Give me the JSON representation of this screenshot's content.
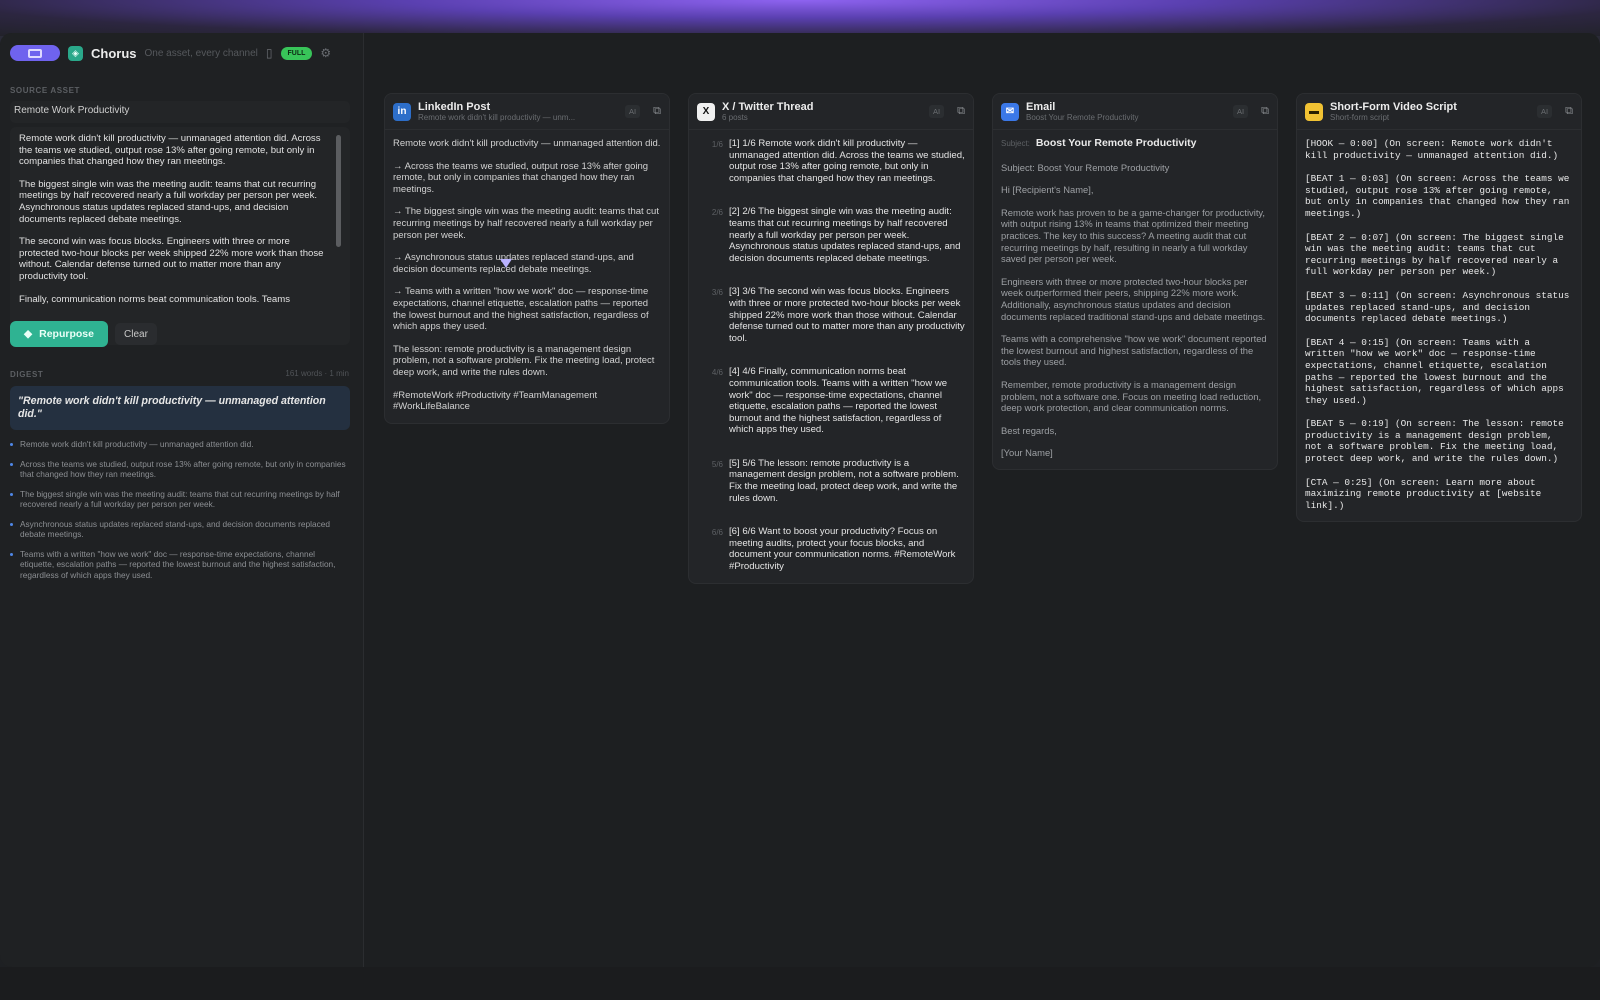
{
  "header": {
    "app_name": "Chorus",
    "tagline": "One asset, every channel",
    "plan_badge": "FULL"
  },
  "source": {
    "section_label": "SOURCE ASSET",
    "title": "Remote Work Productivity",
    "paragraphs": [
      "Remote work didn't kill productivity — unmanaged attention did. Across the teams we studied, output rose 13% after going remote, but only in companies that changed how they ran meetings.",
      "The biggest single win was the meeting audit: teams that cut recurring meetings by half recovered nearly a full workday per person per week. Asynchronous status updates replaced stand-ups, and decision documents replaced debate meetings.",
      "The second win was focus blocks. Engineers with three or more protected two-hour blocks per week shipped 22% more work than those without. Calendar defense turned out to matter more than any productivity tool.",
      "Finally, communication norms beat communication tools. Teams"
    ],
    "repurpose_label": "Repurpose",
    "clear_label": "Clear"
  },
  "digest": {
    "section_label": "DIGEST",
    "meta": "161 words · 1 min",
    "quote": "\"Remote work didn't kill productivity — unmanaged attention did.\"",
    "items": [
      "Remote work didn't kill productivity — unmanaged attention did.",
      "Across the teams we studied, output rose 13% after going remote, but only in companies that changed how they ran meetings.",
      "The biggest single win was the meeting audit: teams that cut recurring meetings by half recovered nearly a full workday per person per week.",
      "Asynchronous status updates replaced stand-ups, and decision documents replaced debate meetings.",
      "Teams with a written \"how we work\" doc — response-time expectations, channel etiquette, escalation paths — reported the lowest burnout and the highest satisfaction, regardless of which apps they used."
    ]
  },
  "cards": {
    "ai_label": "AI",
    "linkedin": {
      "icon": "in",
      "title": "LinkedIn Post",
      "subtitle": "Remote work didn't kill productivity — unm...",
      "paragraphs": [
        "Remote work didn't kill productivity — unmanaged attention did.",
        "→ Across the teams we studied, output rose 13% after going remote, but only in companies that changed how they ran meetings.",
        "→ The biggest single win was the meeting audit: teams that cut recurring meetings by half recovered nearly a full workday per person per week.",
        "→ Asynchronous status updates replaced stand-ups, and decision documents replaced debate meetings.",
        "→ Teams with a written \"how we work\" doc — response-time expectations, channel etiquette, escalation paths — reported the lowest burnout and the highest satisfaction, regardless of which apps they used.",
        "The lesson: remote productivity is a management design problem, not a software problem. Fix the meeting load, protect deep work, and write the rules down.",
        "#RemoteWork #Productivity #TeamManagement #WorkLifeBalance"
      ]
    },
    "twitter": {
      "icon": "X",
      "title": "X / Twitter Thread",
      "subtitle": "6 posts",
      "posts": [
        {
          "n": "1/6",
          "text": "[1] 1/6 Remote work didn't kill productivity — unmanaged attention did. Across the teams we studied, output rose 13% after going remote, but only in companies that changed how they ran meetings."
        },
        {
          "n": "2/6",
          "text": "[2] 2/6 The biggest single win was the meeting audit: teams that cut recurring meetings by half recovered nearly a full workday per person per week. Asynchronous status updates replaced stand-ups, and decision documents replaced debate meetings."
        },
        {
          "n": "3/6",
          "text": "[3] 3/6 The second win was focus blocks. Engineers with three or more protected two-hour blocks per week shipped 22% more work than those without. Calendar defense turned out to matter more than any productivity tool."
        },
        {
          "n": "4/6",
          "text": "[4] 4/6 Finally, communication norms beat communication tools. Teams with a written \"how we work\" doc — response-time expectations, channel etiquette, escalation paths — reported the lowest burnout and the highest satisfaction, regardless of which apps they used."
        },
        {
          "n": "5/6",
          "text": "[5] 5/6 The lesson: remote productivity is a management design problem, not a software problem. Fix the meeting load, protect deep work, and write the rules down."
        },
        {
          "n": "6/6",
          "text": "[6] 6/6 Want to boost your productivity? Focus on meeting audits, protect your focus blocks, and document your communication norms. #RemoteWork #Productivity"
        }
      ]
    },
    "email": {
      "icon": "✉",
      "title": "Email",
      "subtitle": "Boost Your Remote Productivity",
      "subject_label": "Subject:",
      "subject": "Boost Your Remote Productivity",
      "paragraphs": [
        "Subject: Boost Your Remote Productivity",
        "Hi [Recipient's Name],",
        "Remote work has proven to be a game-changer for productivity, with output rising 13% in teams that optimized their meeting practices. The key to this success? A meeting audit that cut recurring meetings by half, resulting in nearly a full workday saved per person per week.",
        "Engineers with three or more protected two-hour blocks per week outperformed their peers, shipping 22% more work. Additionally, asynchronous status updates and decision documents replaced traditional stand-ups and debate meetings.",
        "Teams with a comprehensive \"how we work\" document reported the lowest burnout and highest satisfaction, regardless of the tools they used.",
        "Remember, remote productivity is a management design problem, not a software one. Focus on meeting load reduction, deep work protection, and clear communication norms.",
        "Best regards,",
        "[Your Name]"
      ]
    },
    "video": {
      "icon": "▬",
      "title": "Short-Form Video Script",
      "subtitle": "Short-form script",
      "beats": [
        "[HOOK — 0:00] (On screen: Remote work didn't kill productivity — unmanaged attention did.)",
        "[BEAT 1 — 0:03] (On screen: Across the teams we studied, output rose 13% after going remote, but only in companies that changed how they ran meetings.)",
        "[BEAT 2 — 0:07] (On screen: The biggest single win was the meeting audit: teams that cut recurring meetings by half recovered nearly a full workday per person per week.)",
        "[BEAT 3 — 0:11] (On screen: Asynchronous status updates replaced stand-ups, and decision documents replaced debate meetings.)",
        "[BEAT 4 — 0:15] (On screen: Teams with a written \"how we work\" doc — response-time expectations, channel etiquette, escalation paths — reported the lowest burnout and the highest satisfaction, regardless of which apps they used.)",
        "[BEAT 5 — 0:19] (On screen: The lesson: remote productivity is a management design problem, not a software problem. Fix the meeting load, protect deep work, and write the rules down.)",
        "[CTA — 0:25] (On screen: Learn more about maximizing remote productivity at [website link].)"
      ]
    }
  }
}
